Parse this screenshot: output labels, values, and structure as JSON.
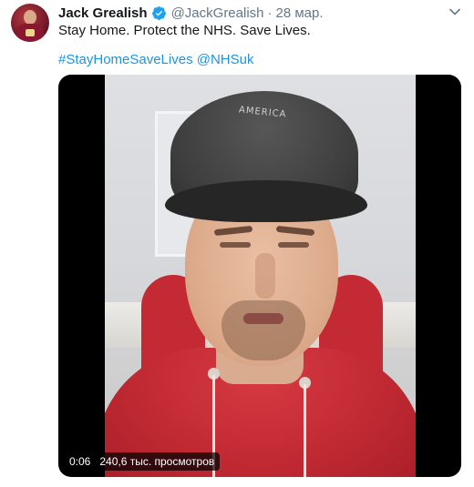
{
  "author": {
    "display_name": "Jack Grealish",
    "handle": "@JackGrealish",
    "separator": "·",
    "date": "28 мар."
  },
  "tweet": {
    "text": "Stay Home. Protect the NHS. Save Lives.",
    "links": [
      "#StayHomeSaveLives",
      "@NHSuk"
    ]
  },
  "video": {
    "current_time": "0:06",
    "views": "240,6 тыс. просмотров",
    "cap_text": "AMERICA"
  },
  "icons": {
    "verified": "verified-badge-icon",
    "more": "chevron-down-icon"
  },
  "colors": {
    "link": "#1b95e0",
    "verified": "#1da1f2",
    "secondary_text": "#657786"
  }
}
